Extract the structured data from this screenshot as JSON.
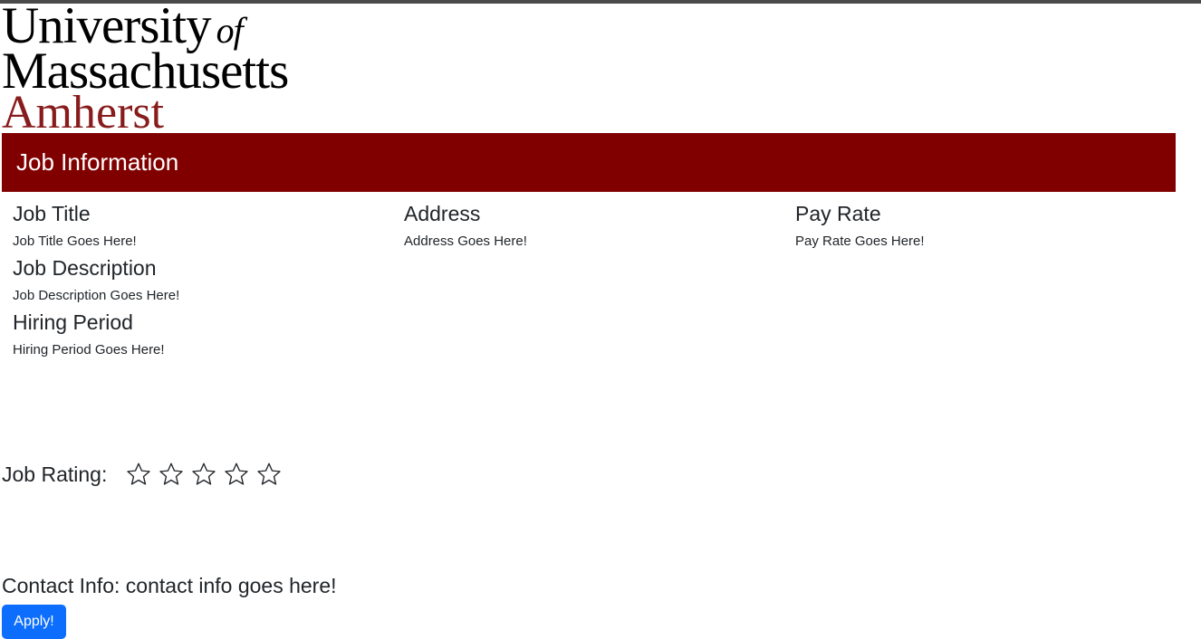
{
  "logo": {
    "line1": "University",
    "of": "of",
    "line2": "Massachusetts",
    "line3": "Amherst",
    "brand_color": "#881c1c"
  },
  "header": {
    "title": "Job Information",
    "bg_color": "#800000"
  },
  "fields": {
    "job_title": {
      "label": "Job Title",
      "value": "Job Title Goes Here!"
    },
    "job_description": {
      "label": "Job Description",
      "value": "Job Description Goes Here!"
    },
    "hiring_period": {
      "label": "Hiring Period",
      "value": "Hiring Period Goes Here!"
    },
    "address": {
      "label": "Address",
      "value": "Address Goes Here!"
    },
    "pay_rate": {
      "label": "Pay Rate",
      "value": "Pay Rate Goes Here!"
    }
  },
  "rating": {
    "label": "Job Rating:",
    "max_stars": 5,
    "selected": 0,
    "icon": "star-outline-icon"
  },
  "contact": {
    "text": "Contact Info: contact info goes here!"
  },
  "apply_button": {
    "label": "Apply!",
    "color": "#0d6efd"
  }
}
